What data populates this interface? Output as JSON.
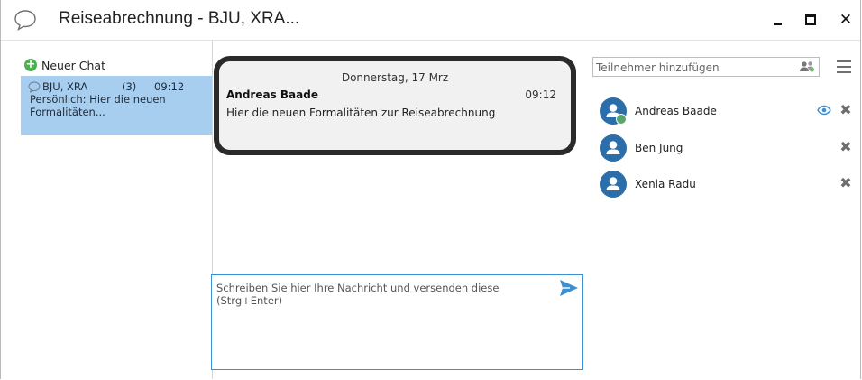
{
  "window": {
    "title": "Reiseabrechnung - BJU, XRA...",
    "close_glyph": "✕"
  },
  "sidebar": {
    "new_chat_label": "Neuer Chat",
    "plus_glyph": "+",
    "chats": [
      {
        "name": "BJU, XRA",
        "count": "(3)",
        "time": "09:12",
        "preview": "Persönlich: Hier die neuen Formalitäten..."
      }
    ]
  },
  "conversation": {
    "date": "Donnerstag, 17 Mrz",
    "messages": [
      {
        "author": "Andreas Baade",
        "time": "09:12",
        "text": "Hier die neuen Formalitäten zur Reiseabrechnung"
      }
    ]
  },
  "compose": {
    "placeholder": "Schreiben Sie hier Ihre Nachricht und versenden diese (Strg+Enter)"
  },
  "participants": {
    "add_placeholder": "Teilnehmer hinzufügen",
    "remove_glyph": "✖",
    "list": [
      {
        "name": "Andreas Baade",
        "status": "online",
        "watching": true
      },
      {
        "name": "Ben Jung",
        "status": "none",
        "watching": false
      },
      {
        "name": "Xenia Radu",
        "status": "none",
        "watching": false
      }
    ]
  },
  "colors": {
    "accent": "#3c8fd3",
    "selected_chat": "#a7ceef",
    "avatar": "#2c6eaa",
    "online": "#5aa469",
    "new_chat_icon": "#4caf50"
  }
}
